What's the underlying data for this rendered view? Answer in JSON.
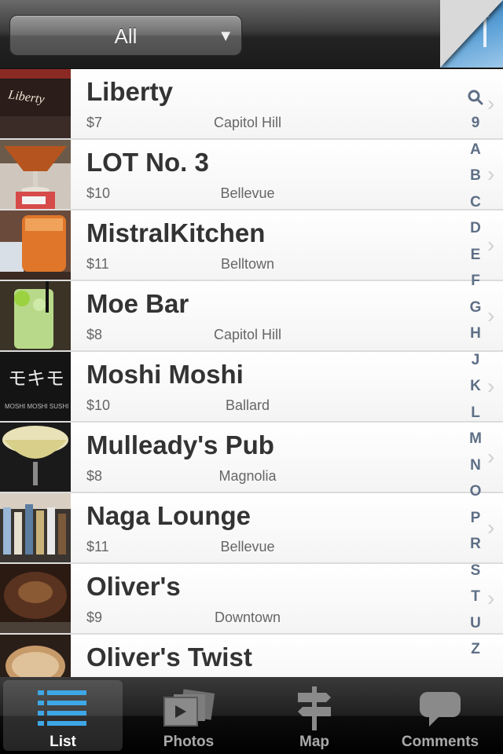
{
  "header": {
    "filter_value": "All",
    "filter_arrow": "▼"
  },
  "venues": [
    {
      "name": "Liberty",
      "price": "$7",
      "area": "Capitol Hill"
    },
    {
      "name": "LOT No. 3",
      "price": "$10",
      "area": "Bellevue"
    },
    {
      "name": "MistralKitchen",
      "price": "$11",
      "area": "Belltown"
    },
    {
      "name": "Moe Bar",
      "price": "$8",
      "area": "Capitol Hill"
    },
    {
      "name": "Moshi Moshi",
      "price": "$10",
      "area": "Ballard"
    },
    {
      "name": "Mulleady's Pub",
      "price": "$8",
      "area": "Magnolia"
    },
    {
      "name": "Naga Lounge",
      "price": "$11",
      "area": "Bellevue"
    },
    {
      "name": "Oliver's",
      "price": "$9",
      "area": "Downtown"
    },
    {
      "name": "Oliver's Twist",
      "price": "",
      "area": ""
    }
  ],
  "thumb_text": {
    "liberty_logo": "Liberty",
    "moshi_sign": "モキモ",
    "moshi_sub": "MOSHI MOSHI SUSHI"
  },
  "section_index": [
    "🔍",
    "9",
    "A",
    "B",
    "C",
    "D",
    "E",
    "F",
    "G",
    "H",
    "J",
    "K",
    "L",
    "M",
    "N",
    "O",
    "P",
    "R",
    "S",
    "T",
    "U",
    "Z"
  ],
  "tabs": [
    {
      "label": "List",
      "icon": "list-icon",
      "selected": true
    },
    {
      "label": "Photos",
      "icon": "photos-icon",
      "selected": false
    },
    {
      "label": "Map",
      "icon": "map-signpost-icon",
      "selected": false
    },
    {
      "label": "Comments",
      "icon": "speech-bubble-icon",
      "selected": false
    }
  ],
  "colors": {
    "accent_blue": "#3ea7e6",
    "index_text": "#5e6f86"
  }
}
